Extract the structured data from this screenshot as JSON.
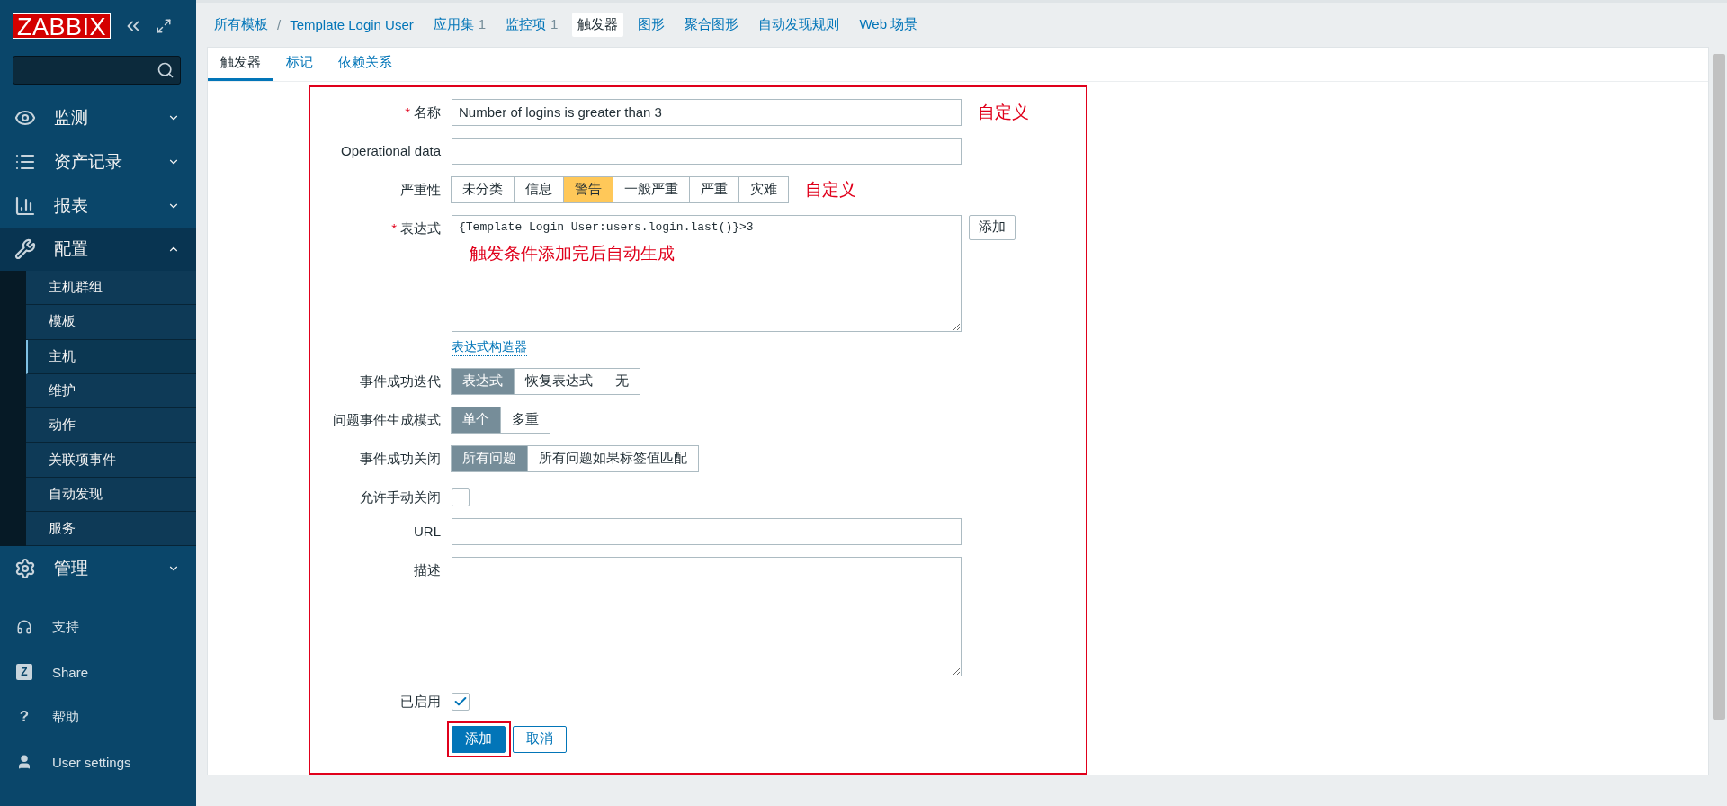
{
  "sidebar": {
    "logo": "ZABBIX",
    "menu": [
      {
        "label": "监测",
        "kind": "eye",
        "expanded": false
      },
      {
        "label": "资产记录",
        "kind": "list",
        "expanded": false
      },
      {
        "label": "报表",
        "kind": "chart",
        "expanded": false
      },
      {
        "label": "配置",
        "kind": "wrench",
        "expanded": true,
        "children": [
          {
            "label": "主机群组",
            "selected": false
          },
          {
            "label": "模板",
            "selected": false
          },
          {
            "label": "主机",
            "selected": true
          },
          {
            "label": "维护",
            "selected": false
          },
          {
            "label": "动作",
            "selected": false
          },
          {
            "label": "关联项事件",
            "selected": false
          },
          {
            "label": "自动发现",
            "selected": false
          },
          {
            "label": "服务",
            "selected": false
          }
        ]
      },
      {
        "label": "管理",
        "kind": "gear",
        "expanded": false
      }
    ],
    "footer": [
      {
        "label": "支持",
        "kind": "headset"
      },
      {
        "label": "Share",
        "kind": "badge",
        "glyph": "Z"
      },
      {
        "label": "帮助",
        "kind": "glyph",
        "glyph": "?"
      },
      {
        "label": "User settings",
        "kind": "user"
      }
    ]
  },
  "nav": {
    "items": [
      {
        "label": "所有模板",
        "kind": "link",
        "selected": false
      },
      {
        "label": "/",
        "kind": "separator",
        "selected": false
      },
      {
        "label": "Template Login User",
        "kind": "link",
        "selected": false
      },
      {
        "label": "应用集",
        "count": "1",
        "kind": "link",
        "selected": false
      },
      {
        "label": "监控项",
        "count": "1",
        "kind": "link",
        "selected": false
      },
      {
        "label": "触发器",
        "kind": "link",
        "selected": true
      },
      {
        "label": "图形",
        "kind": "link",
        "selected": false
      },
      {
        "label": "聚合图形",
        "kind": "link",
        "selected": false
      },
      {
        "label": "自动发现规则",
        "kind": "link",
        "selected": false
      },
      {
        "label": "Web 场景",
        "kind": "link",
        "selected": false
      }
    ]
  },
  "tabs": [
    {
      "label": "触发器",
      "selected": true
    },
    {
      "label": "标记",
      "selected": false
    },
    {
      "label": "依赖关系",
      "selected": false
    }
  ],
  "form": {
    "highlighted": true,
    "rows": [
      {
        "kind": "text",
        "label": "名称",
        "marker": "*",
        "value": "Number of logins is greater than 3",
        "note": "自定义"
      },
      {
        "kind": "text",
        "label": "Operational data"
      },
      {
        "kind": "severity",
        "label": "严重性",
        "note": "自定义",
        "options": [
          {
            "label": "未分类",
            "selected": false
          },
          {
            "label": "信息",
            "selected": false
          },
          {
            "label": "警告",
            "selected": true
          },
          {
            "label": "一般严重",
            "selected": false
          },
          {
            "label": "严重",
            "selected": false
          },
          {
            "label": "灾难",
            "selected": false
          }
        ]
      },
      {
        "kind": "expression",
        "label": "表达式",
        "marker": "*",
        "value": "{Template Login User:users.login.last()}>3",
        "note": "触发条件添加完后自动生成",
        "button": "添加",
        "link": "表达式构造器"
      },
      {
        "kind": "segmented",
        "label": "事件成功迭代",
        "options": [
          {
            "label": "表达式",
            "selected": true
          },
          {
            "label": "恢复表达式",
            "selected": false
          },
          {
            "label": "无",
            "selected": false
          }
        ]
      },
      {
        "kind": "segmented",
        "label": "问题事件生成模式",
        "options": [
          {
            "label": "单个",
            "selected": true
          },
          {
            "label": "多重",
            "selected": false
          }
        ]
      },
      {
        "kind": "segmented",
        "label": "事件成功关闭",
        "options": [
          {
            "label": "所有问题",
            "selected": true
          },
          {
            "label": "所有问题如果标签值匹配",
            "selected": false
          }
        ]
      },
      {
        "kind": "checkbox",
        "label": "允许手动关闭",
        "checked": false
      },
      {
        "kind": "text",
        "label": "URL"
      },
      {
        "kind": "textarea",
        "label": "描述"
      },
      {
        "kind": "checkbox",
        "label": "已启用",
        "checked": true
      }
    ],
    "buttons": [
      {
        "label": "添加",
        "primary": true,
        "highlighted": true
      },
      {
        "label": "取消",
        "primary": false
      }
    ]
  }
}
